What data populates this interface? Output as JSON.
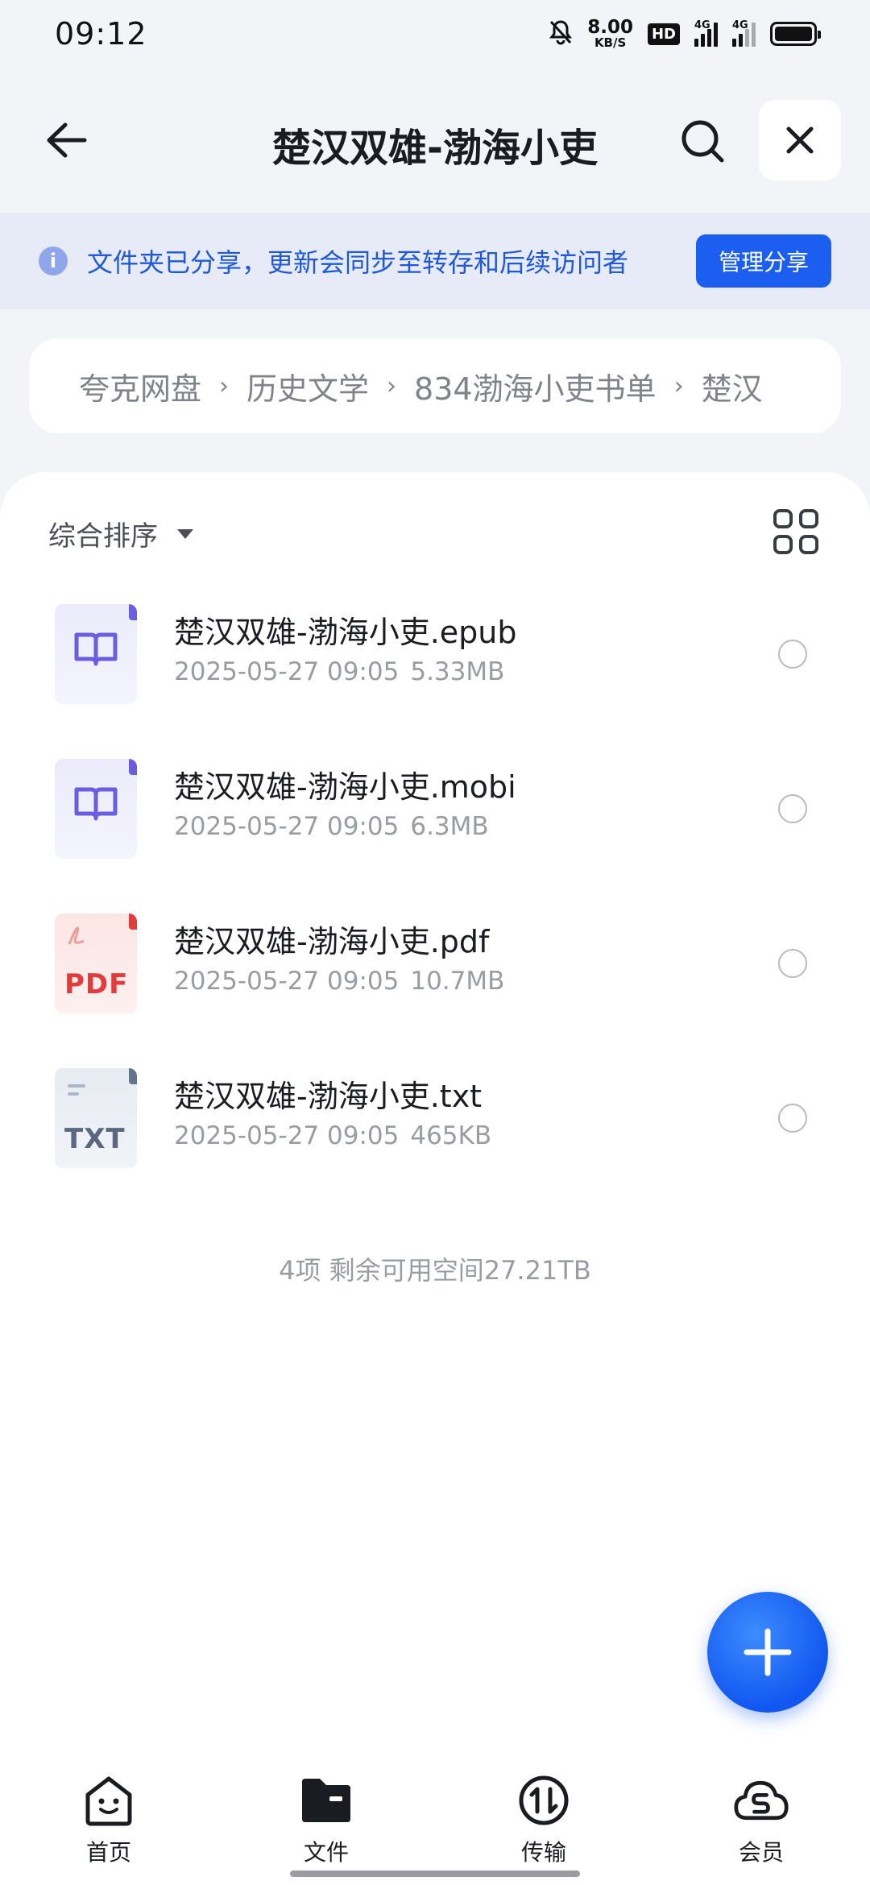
{
  "status_bar": {
    "time": "09:12",
    "net_speed_value": "8.00",
    "net_speed_unit": "KB/S",
    "hd_badge": "HD",
    "signal_1_label": "4G",
    "signal_2_label": "4G",
    "icons": [
      "bell-off-icon",
      "signal-icon",
      "signal-icon",
      "battery-icon"
    ]
  },
  "header": {
    "title": "楚汉双雄-渤海小吏",
    "back_icon": "arrow-left-icon",
    "search_icon": "search-icon",
    "close_icon": "close-icon"
  },
  "share_banner": {
    "text": "文件夹已分享，更新会同步至转存和后续访问者",
    "button_label": "管理分享",
    "accent": "#1b5ef0"
  },
  "breadcrumb": {
    "items": [
      "夸克网盘",
      "历史文学",
      "834渤海小吏书单",
      "楚汉"
    ]
  },
  "sort": {
    "label": "综合排序"
  },
  "files": [
    {
      "name": "楚汉双雄-渤海小吏.epub",
      "date": "2025-05-27 09:05",
      "size": "5.33MB",
      "type": "book"
    },
    {
      "name": "楚汉双雄-渤海小吏.mobi",
      "date": "2025-05-27 09:05",
      "size": "6.3MB",
      "type": "book"
    },
    {
      "name": "楚汉双雄-渤海小吏.pdf",
      "date": "2025-05-27 09:05",
      "size": "10.7MB",
      "type": "pdf",
      "icon_text": "PDF"
    },
    {
      "name": "楚汉双雄-渤海小吏.txt",
      "date": "2025-05-27 09:05",
      "size": "465KB",
      "type": "txt",
      "icon_text": "TXT"
    }
  ],
  "footer_note": "4项 剩余可用空间27.21TB",
  "bottom_nav": {
    "items": [
      {
        "label": "首页",
        "icon": "home-icon"
      },
      {
        "label": "文件",
        "icon": "folder-icon"
      },
      {
        "label": "传输",
        "icon": "transfer-icon"
      },
      {
        "label": "会员",
        "icon": "member-icon"
      }
    ]
  }
}
